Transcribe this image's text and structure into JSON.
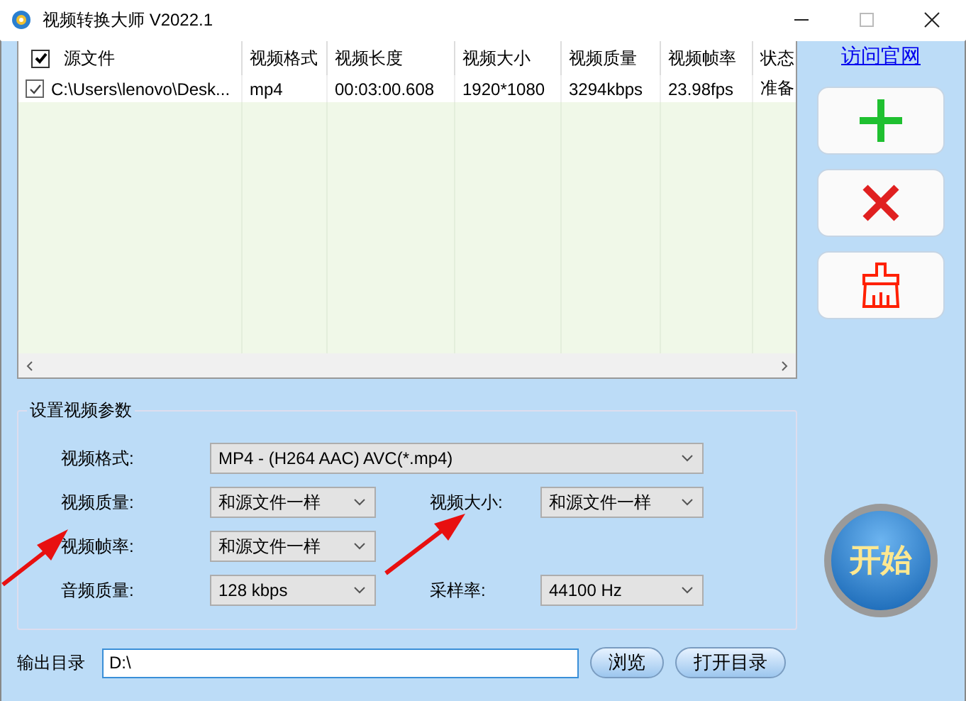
{
  "window": {
    "title": "视频转换大师 V2022.1"
  },
  "table": {
    "header_checked": true,
    "columns": [
      "源文件",
      "视频格式",
      "视频长度",
      "视频大小",
      "视频质量",
      "视频帧率",
      "状态"
    ],
    "rows": [
      {
        "checked": true,
        "cells": [
          "C:\\Users\\lenovo\\Desk...",
          "mp4",
          "00:03:00.608",
          "1920*1080",
          "3294kbps",
          "23.98fps",
          "准备"
        ]
      }
    ]
  },
  "link": "访问官网",
  "settings": {
    "title": "设置视频参数",
    "rows": [
      [
        {
          "label": "视频格式:",
          "value": "MP4 - (H264 AAC) AVC(*.mp4)"
        }
      ],
      [
        {
          "label": "视频质量:",
          "value": "和源文件一样"
        },
        {
          "label": "视频大小:",
          "value": "和源文件一样"
        }
      ],
      [
        {
          "label": "视频帧率:",
          "value": "和源文件一样"
        }
      ],
      [
        {
          "label": "音频质量:",
          "value": "128 kbps"
        },
        {
          "label": "采样率:",
          "value": "44100 Hz"
        }
      ]
    ]
  },
  "output": {
    "label": "输出目录",
    "value": "D:\\",
    "buttons": [
      "浏览",
      "打开目录"
    ]
  },
  "start_button": "开始"
}
